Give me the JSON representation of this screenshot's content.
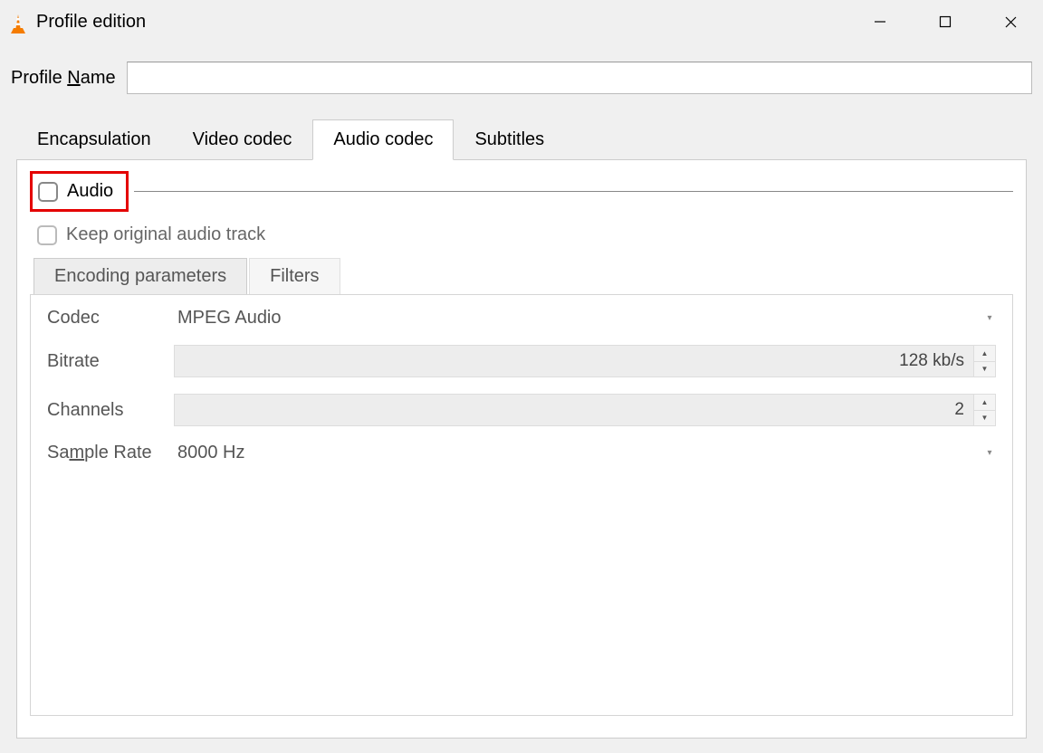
{
  "window": {
    "title": "Profile edition"
  },
  "profile": {
    "name_label_pre": "Profile ",
    "name_label_u": "N",
    "name_label_post": "ame",
    "name_value": ""
  },
  "tabs": {
    "encapsulation": "Encapsulation",
    "video_codec": "Video codec",
    "audio_codec": "Audio codec",
    "subtitles": "Subtitles"
  },
  "audio_tab": {
    "audio_checkbox_label": "Audio",
    "keep_original_label": "Keep original audio track",
    "subtabs": {
      "encoding": "Encoding parameters",
      "filters": "Filters"
    },
    "params": {
      "codec_label": "Codec",
      "codec_value": "MPEG Audio",
      "bitrate_label": "Bitrate",
      "bitrate_value": "128 kb/s",
      "channels_label": "Channels",
      "channels_value": "2",
      "samplerate_label_pre": "Sa",
      "samplerate_label_u": "m",
      "samplerate_label_post": "ple Rate",
      "samplerate_value": "8000 Hz"
    }
  }
}
